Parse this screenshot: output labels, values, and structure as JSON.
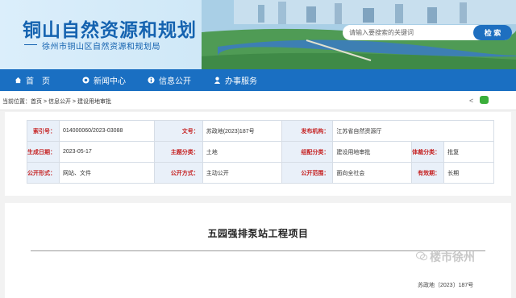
{
  "header": {
    "title": "铜山自然资源和规划",
    "subtitle": "徐州市铜山区自然资源和规划局",
    "search_placeholder": "请输入要搜索的关键词",
    "search_button": "检 索"
  },
  "nav": {
    "items": [
      {
        "label": "首　页",
        "icon": "home-icon"
      },
      {
        "label": "新闻中心",
        "icon": "news-icon"
      },
      {
        "label": "信息公开",
        "icon": "info-icon"
      },
      {
        "label": "办事服务",
        "icon": "service-icon"
      }
    ]
  },
  "breadcrumb": {
    "text": "当前位置：首页 > 信息公开 > 建设用地审批"
  },
  "meta": {
    "index_no_label": "索引号：",
    "index_no": "014000060/2023-03088",
    "doc_no_label": "文号：",
    "doc_no": "苏政地(2023)187号",
    "issuer_label": "发布机构：",
    "issuer": "江苏省自然资源厅",
    "date_label": "生成日期：",
    "date": "2023-05-17",
    "topic_label": "主题分类：",
    "topic": "土地",
    "org_label": "组配分类：",
    "org": "建设用地审批",
    "genre_label": "体裁分类：",
    "genre": "批复",
    "form_label": "公开形式：",
    "form": "网站、文件",
    "mode_label": "公开方式：",
    "mode": "主动公开",
    "scope_label": "公开范围：",
    "scope": "面向全社会",
    "validity_label": "有效期：",
    "validity": "长期"
  },
  "article": {
    "title": "五园强排泵站工程项目",
    "doc_no": "苏政地〔2023〕187号"
  },
  "watermark": {
    "text": "楼市徐州"
  },
  "colors": {
    "nav_bg": "#1a6fc2",
    "title_blue": "#1563b0",
    "label_red": "#c51f1f",
    "label_bg": "#e9f0f9"
  }
}
